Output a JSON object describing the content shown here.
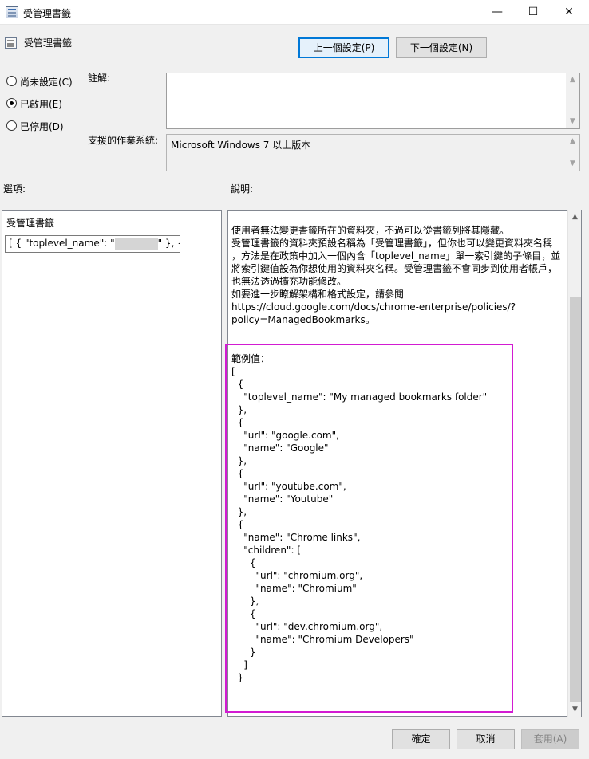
{
  "window": {
    "title": "受管理書籤",
    "controls": {
      "minimize": "—",
      "maximize": "☐",
      "close": "✕"
    }
  },
  "header": {
    "policy_name": "受管理書籤",
    "prev_button": "上一個設定(P)",
    "next_button": "下一個設定(N)"
  },
  "state": {
    "not_configured": "尚未設定(C)",
    "enabled": "已啟用(E)",
    "disabled": "已停用(D)",
    "selected": "enabled"
  },
  "comment": {
    "label": "註解:",
    "value": ""
  },
  "supported": {
    "label": "支援的作業系統:",
    "value": "Microsoft Windows 7 以上版本"
  },
  "options": {
    "label": "選項:",
    "field_label": "受管理書籤",
    "field_value_start": "[ {   \"toplevel_name\": \"",
    "field_value_end": "\" },  {"
  },
  "help": {
    "label": "說明:",
    "lines": [
      "使用者無法變更書籤所在的資料夾，不過可以從書籤列將其隱藏。",
      "受管理書籤的資料夾預設名稱為「受管理書籤」，但你也可以變更資料夾名稱",
      "，方法是在政策中加入一個內含「toplevel_name」單一索引鍵的子條目，並",
      "將索引鍵值設為你想使用的資料夾名稱。受管理書籤不會同步到使用者帳戶，",
      "也無法透過擴充功能修改。",
      "如要進一步瞭解架構和格式設定，請參閱",
      "https://cloud.google.com/docs/chrome-enterprise/policies/?",
      "policy=ManagedBookmarks。"
    ],
    "example_lines": [
      "範例值：",
      "",
      "[",
      "  {",
      "    \"toplevel_name\": \"My managed bookmarks folder\"",
      "  },",
      "  {",
      "    \"url\": \"google.com\",",
      "    \"name\": \"Google\"",
      "  },",
      "  {",
      "    \"url\": \"youtube.com\",",
      "    \"name\": \"Youtube\"",
      "  },",
      "  {",
      "    \"name\": \"Chrome links\",",
      "    \"children\": [",
      "      {",
      "        \"url\": \"chromium.org\",",
      "        \"name\": \"Chromium\"",
      "      },",
      "      {",
      "        \"url\": \"dev.chromium.org\",",
      "        \"name\": \"Chromium Developers\"",
      "      }",
      "    ]",
      "  }",
      "]"
    ]
  },
  "footer": {
    "ok": "確定",
    "cancel": "取消",
    "apply": "套用(A)"
  },
  "colors": {
    "highlight_box": "#d21bd2",
    "accent": "#0078d7"
  }
}
